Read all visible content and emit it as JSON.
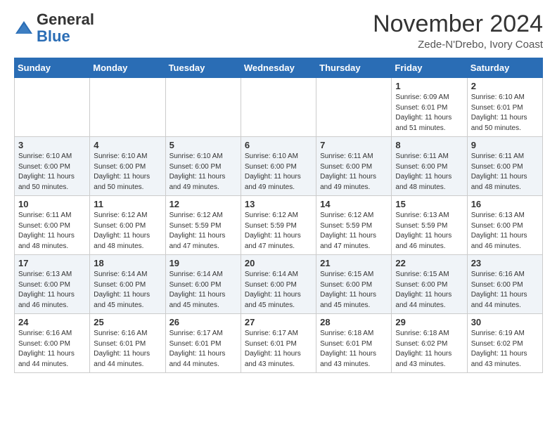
{
  "header": {
    "logo_general": "General",
    "logo_blue": "Blue",
    "month_title": "November 2024",
    "location": "Zede-N'Drebo, Ivory Coast"
  },
  "days_of_week": [
    "Sunday",
    "Monday",
    "Tuesday",
    "Wednesday",
    "Thursday",
    "Friday",
    "Saturday"
  ],
  "weeks": [
    [
      {
        "day": "",
        "info": ""
      },
      {
        "day": "",
        "info": ""
      },
      {
        "day": "",
        "info": ""
      },
      {
        "day": "",
        "info": ""
      },
      {
        "day": "",
        "info": ""
      },
      {
        "day": "1",
        "info": "Sunrise: 6:09 AM\nSunset: 6:01 PM\nDaylight: 11 hours\nand 51 minutes."
      },
      {
        "day": "2",
        "info": "Sunrise: 6:10 AM\nSunset: 6:01 PM\nDaylight: 11 hours\nand 50 minutes."
      }
    ],
    [
      {
        "day": "3",
        "info": "Sunrise: 6:10 AM\nSunset: 6:00 PM\nDaylight: 11 hours\nand 50 minutes."
      },
      {
        "day": "4",
        "info": "Sunrise: 6:10 AM\nSunset: 6:00 PM\nDaylight: 11 hours\nand 50 minutes."
      },
      {
        "day": "5",
        "info": "Sunrise: 6:10 AM\nSunset: 6:00 PM\nDaylight: 11 hours\nand 49 minutes."
      },
      {
        "day": "6",
        "info": "Sunrise: 6:10 AM\nSunset: 6:00 PM\nDaylight: 11 hours\nand 49 minutes."
      },
      {
        "day": "7",
        "info": "Sunrise: 6:11 AM\nSunset: 6:00 PM\nDaylight: 11 hours\nand 49 minutes."
      },
      {
        "day": "8",
        "info": "Sunrise: 6:11 AM\nSunset: 6:00 PM\nDaylight: 11 hours\nand 48 minutes."
      },
      {
        "day": "9",
        "info": "Sunrise: 6:11 AM\nSunset: 6:00 PM\nDaylight: 11 hours\nand 48 minutes."
      }
    ],
    [
      {
        "day": "10",
        "info": "Sunrise: 6:11 AM\nSunset: 6:00 PM\nDaylight: 11 hours\nand 48 minutes."
      },
      {
        "day": "11",
        "info": "Sunrise: 6:12 AM\nSunset: 6:00 PM\nDaylight: 11 hours\nand 48 minutes."
      },
      {
        "day": "12",
        "info": "Sunrise: 6:12 AM\nSunset: 5:59 PM\nDaylight: 11 hours\nand 47 minutes."
      },
      {
        "day": "13",
        "info": "Sunrise: 6:12 AM\nSunset: 5:59 PM\nDaylight: 11 hours\nand 47 minutes."
      },
      {
        "day": "14",
        "info": "Sunrise: 6:12 AM\nSunset: 5:59 PM\nDaylight: 11 hours\nand 47 minutes."
      },
      {
        "day": "15",
        "info": "Sunrise: 6:13 AM\nSunset: 5:59 PM\nDaylight: 11 hours\nand 46 minutes."
      },
      {
        "day": "16",
        "info": "Sunrise: 6:13 AM\nSunset: 6:00 PM\nDaylight: 11 hours\nand 46 minutes."
      }
    ],
    [
      {
        "day": "17",
        "info": "Sunrise: 6:13 AM\nSunset: 6:00 PM\nDaylight: 11 hours\nand 46 minutes."
      },
      {
        "day": "18",
        "info": "Sunrise: 6:14 AM\nSunset: 6:00 PM\nDaylight: 11 hours\nand 45 minutes."
      },
      {
        "day": "19",
        "info": "Sunrise: 6:14 AM\nSunset: 6:00 PM\nDaylight: 11 hours\nand 45 minutes."
      },
      {
        "day": "20",
        "info": "Sunrise: 6:14 AM\nSunset: 6:00 PM\nDaylight: 11 hours\nand 45 minutes."
      },
      {
        "day": "21",
        "info": "Sunrise: 6:15 AM\nSunset: 6:00 PM\nDaylight: 11 hours\nand 45 minutes."
      },
      {
        "day": "22",
        "info": "Sunrise: 6:15 AM\nSunset: 6:00 PM\nDaylight: 11 hours\nand 44 minutes."
      },
      {
        "day": "23",
        "info": "Sunrise: 6:16 AM\nSunset: 6:00 PM\nDaylight: 11 hours\nand 44 minutes."
      }
    ],
    [
      {
        "day": "24",
        "info": "Sunrise: 6:16 AM\nSunset: 6:00 PM\nDaylight: 11 hours\nand 44 minutes."
      },
      {
        "day": "25",
        "info": "Sunrise: 6:16 AM\nSunset: 6:01 PM\nDaylight: 11 hours\nand 44 minutes."
      },
      {
        "day": "26",
        "info": "Sunrise: 6:17 AM\nSunset: 6:01 PM\nDaylight: 11 hours\nand 44 minutes."
      },
      {
        "day": "27",
        "info": "Sunrise: 6:17 AM\nSunset: 6:01 PM\nDaylight: 11 hours\nand 43 minutes."
      },
      {
        "day": "28",
        "info": "Sunrise: 6:18 AM\nSunset: 6:01 PM\nDaylight: 11 hours\nand 43 minutes."
      },
      {
        "day": "29",
        "info": "Sunrise: 6:18 AM\nSunset: 6:02 PM\nDaylight: 11 hours\nand 43 minutes."
      },
      {
        "day": "30",
        "info": "Sunrise: 6:19 AM\nSunset: 6:02 PM\nDaylight: 11 hours\nand 43 minutes."
      }
    ]
  ]
}
